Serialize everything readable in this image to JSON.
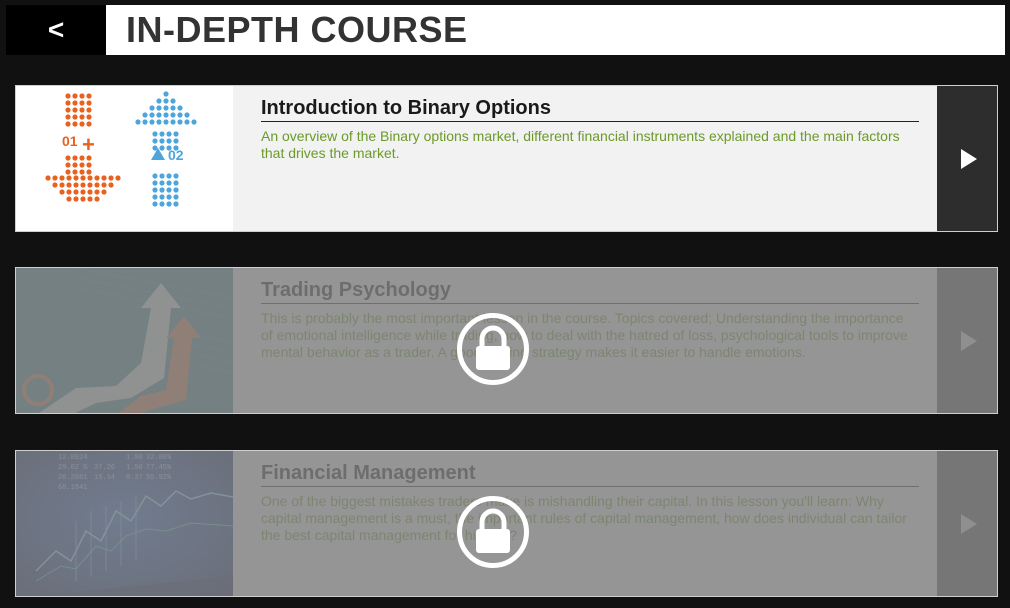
{
  "header": {
    "back_label": "<",
    "title": "IN-DEPTH COURSE"
  },
  "courses": [
    {
      "title": "Introduction to Binary Options",
      "description": "An overview of the Binary options market, different financial instruments explained and the main factors that drives the market.",
      "locked": false,
      "thumb_labels": [
        "01",
        "02"
      ]
    },
    {
      "title": "Trading Psychology",
      "description": "This is probably the most important lesson in the course. Topics covered; Understanding the importance of emotional intelligence while trading, how to deal with the hatred of loss, psychological tools to improve mental behavior as a trader. A good trading strategy makes it easier to handle emotions.",
      "locked": true
    },
    {
      "title": "Financial Management",
      "description": "One of the biggest mistakes traders make is mishandling their capital. In this lesson you'll learn: Why capital management is a must, the important rules of capital management, how does individual can tailor the best capital management for himself?",
      "locked": true,
      "thumb_labels": [
        "12.0924",
        "29.02 %",
        "26.2081",
        "68.1841",
        "37.26",
        "15.14",
        "1.00",
        "1.50",
        "0.37",
        "32.00%",
        "77.45%",
        "55.92%"
      ]
    }
  ],
  "colors": {
    "background": "#111111",
    "card_bg": "#f2f2f2",
    "description_green": "#6b9a2a",
    "play_bg": "#2d2d2d",
    "orange": "#e8621f",
    "blue": "#4ea5dc"
  },
  "icons": {
    "play": "play-icon",
    "lock": "lock-icon"
  }
}
